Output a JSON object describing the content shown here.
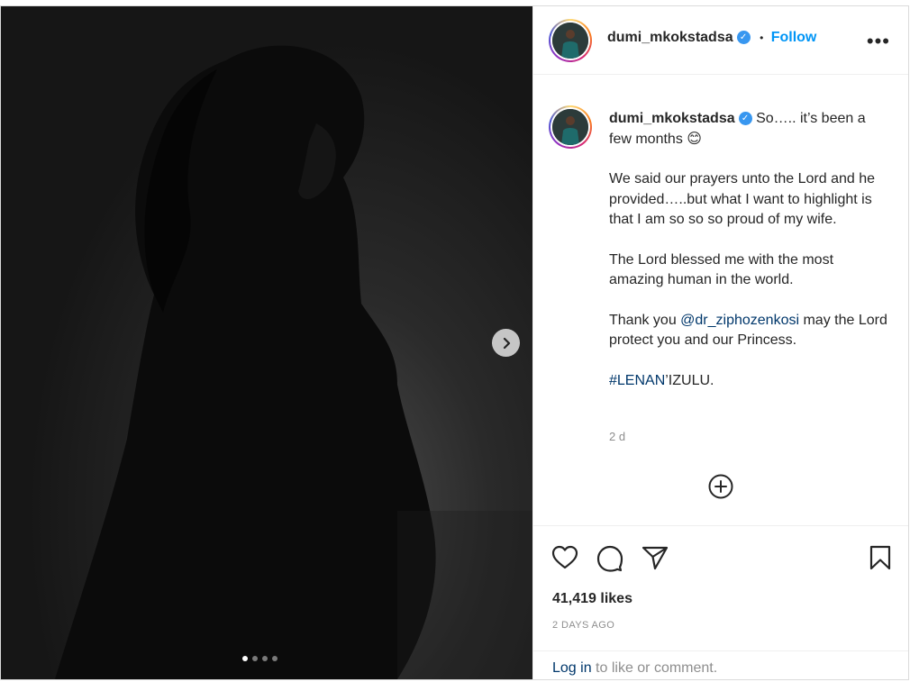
{
  "post": {
    "username": "dumi_mkokstadsa",
    "verified_mark": "✓",
    "separator": "•",
    "follow_label": "Follow",
    "more_label": "•••",
    "carousel": {
      "total_slides": 4,
      "active_slide": 1
    }
  },
  "caption": {
    "username": "dumi_mkokstadsa",
    "line1": "So….. it’s been a few months 😊",
    "para1": "We said our prayers unto the Lord and he provided…..but what I want to highlight is that I am so so so proud of my wife.",
    "para2": "The Lord blessed me with the most amazing human in the world.",
    "para3_before": "Thank you ",
    "para3_mention": "@dr_ziphozenkosi",
    "para3_after": " may the Lord protect you and our Princess.",
    "hashtag": "#LENAN",
    "hashtag_after": "’IZULU.",
    "time": "2 d"
  },
  "stats": {
    "likes": "41,419 likes",
    "posted": "2 DAYS AGO"
  },
  "login": {
    "link": "Log in",
    "rest": " to like or comment."
  },
  "icons": [
    "chevron-right-icon",
    "heart-icon",
    "comment-icon",
    "share-icon",
    "bookmark-icon",
    "add-circle-icon",
    "verified-icon",
    "more-icon"
  ]
}
